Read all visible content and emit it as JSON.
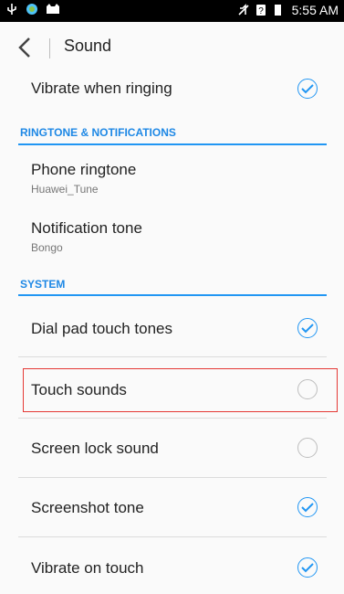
{
  "status_bar": {
    "time": "5:55 AM",
    "icons": [
      "usb-icon",
      "app-icon",
      "cat-icon",
      "mute-icon",
      "sim-icon",
      "battery-icon"
    ]
  },
  "app_bar": {
    "title": "Sound",
    "back_icon": "chevron-left-icon"
  },
  "items": [
    {
      "label": "Vibrate when ringing",
      "checked": true
    },
    {
      "section": "RINGTONE & NOTIFICATIONS"
    },
    {
      "label": "Phone ringtone",
      "summary": "Huawei_Tune"
    },
    {
      "label": "Notification tone",
      "summary": "Bongo"
    },
    {
      "section": "SYSTEM"
    },
    {
      "label": "Dial pad touch tones",
      "checked": true
    },
    {
      "label": "Touch sounds",
      "checked": false
    },
    {
      "label": "Screen lock sound",
      "checked": false
    },
    {
      "label": "Screenshot tone",
      "checked": true
    },
    {
      "label": "Vibrate on touch",
      "checked": true
    }
  ],
  "colors": {
    "accent": "#2196f3",
    "highlight": "#e53935"
  }
}
